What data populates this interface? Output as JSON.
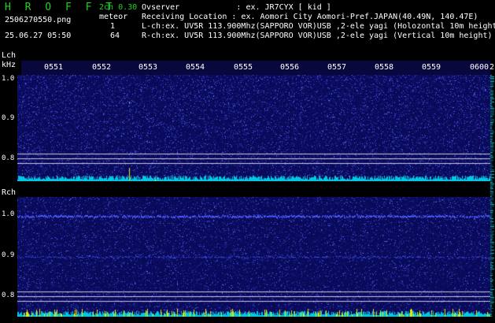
{
  "header": {
    "brand": "H R O F F T",
    "version": "2ch 0.30",
    "filename": "2506270550.png",
    "meteor_label": "meteor",
    "lch_count": "1",
    "rch_count": "64",
    "datetime": "25.06.27 05:50",
    "info_lines": [
      "Ovserver            : ex. JR7CYX [ kid ]",
      "Receiving Location : ex. Aomori City Aomori-Pref.JAPAN(40.49N, 140.47E)",
      "L-ch:ex. UV5R 113.900Mhz(SAPPORO VOR)USB ,2-ele yagi (Holozontal 10m height)",
      "R-ch:ex. UV5R 113.900Mhz(SAPPORO VOR)USB ,2-ele yagi (Vertical 10m height)"
    ]
  },
  "time_axis": {
    "labels": [
      "0551",
      "0552",
      "0553",
      "0554",
      "0555",
      "0556",
      "0557",
      "0558",
      "0559",
      "0600",
      "2"
    ]
  },
  "lch": {
    "title": "Lch",
    "unit": "kHz",
    "freq_ticks": [
      "1.0",
      "0.9",
      "0.8"
    ],
    "meteor_count": 1
  },
  "rch": {
    "title": "Rch",
    "freq_ticks": [
      "1.0",
      "0.9",
      "0.8"
    ],
    "meteor_count": 64
  },
  "colors": {
    "background": "#000000",
    "waterfall_base": "#0a0a5a",
    "noise_dot": "#3040c0",
    "signal_line": "#4a5cff",
    "bottom_noise": "#00c8e0",
    "bottom_spike": "#e8e800",
    "brand_green": "#1fd11f",
    "text": "#ffffff"
  }
}
